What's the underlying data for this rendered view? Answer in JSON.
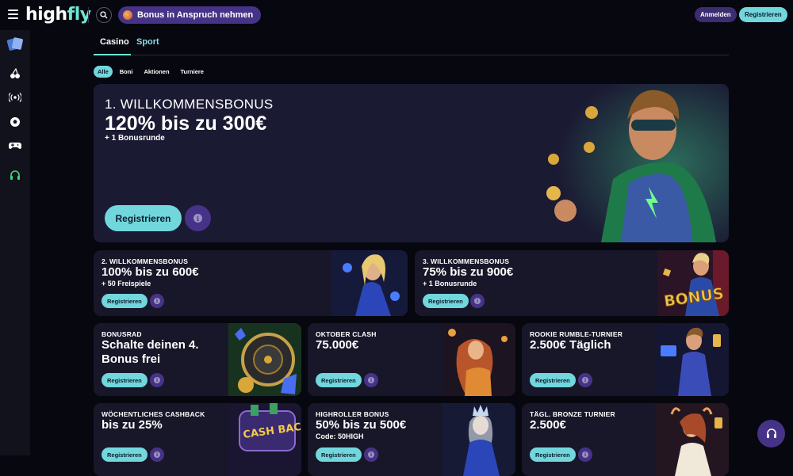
{
  "header": {
    "logo_high": "high",
    "logo_fly": "fly",
    "bonus_pill": "Bonus in Anspruch nehmen",
    "login": "Anmelden",
    "register": "Registrieren"
  },
  "sidebar": {
    "items": [
      {
        "icon": "casino-cards-icon"
      },
      {
        "icon": "cherries-icon"
      },
      {
        "icon": "live-broadcast-icon"
      },
      {
        "icon": "football-icon"
      },
      {
        "icon": "gamepad-icon"
      },
      {
        "icon": "support-headset-icon"
      }
    ]
  },
  "tabs": {
    "casino": "Casino",
    "sport": "Sport"
  },
  "filters": [
    "Alle",
    "Boni",
    "Aktionen",
    "Turniere"
  ],
  "hero": {
    "kicker": "1. WILLKOMMENSBONUS",
    "headline": "120% bis zu 300€",
    "sub": "+ 1 Bonusrunde",
    "button": "Registrieren"
  },
  "promos": {
    "welcome2": {
      "kicker": "2. WILLKOMMENSBONUS",
      "headline": "100% bis zu 600€",
      "sub": "+ 50 Freispiele",
      "button": "Registrieren"
    },
    "welcome3": {
      "kicker": "3. WILLKOMMENSBONUS",
      "headline": "75% bis zu 900€",
      "sub": "+ 1 Bonusrunde",
      "button": "Registrieren",
      "art_text": "BONUS"
    },
    "bonusrad": {
      "kicker": "BONUSRAD",
      "headline": "Schalte deinen 4. Bonus frei",
      "button": "Registrieren"
    },
    "oktober": {
      "kicker": "OKTOBER CLASH",
      "headline": "75.000€",
      "button": "Registrieren"
    },
    "rookie": {
      "kicker": "ROOKIE RUMBLE-TURNIER",
      "headline": "2.500€ Täglich",
      "button": "Registrieren"
    },
    "cashback": {
      "kicker": "WÖCHENTLICHES CASHBACK",
      "headline": "bis zu 25%",
      "button": "Registrieren",
      "art_text": "CASH BACK"
    },
    "highroller": {
      "kicker": "HIGHROLLER BONUS",
      "headline": "50% bis zu 500€",
      "sub": "Code: 50HIGH",
      "button": "Registrieren"
    },
    "bronze": {
      "kicker": "TÄGL. BRONZE TURNIER",
      "headline": "2.500€",
      "button": "Registrieren"
    }
  },
  "colors": {
    "accent": "#72d7dc",
    "purple": "#463387",
    "card_bg": "#181729",
    "hero_bg": "#1b1a33"
  }
}
